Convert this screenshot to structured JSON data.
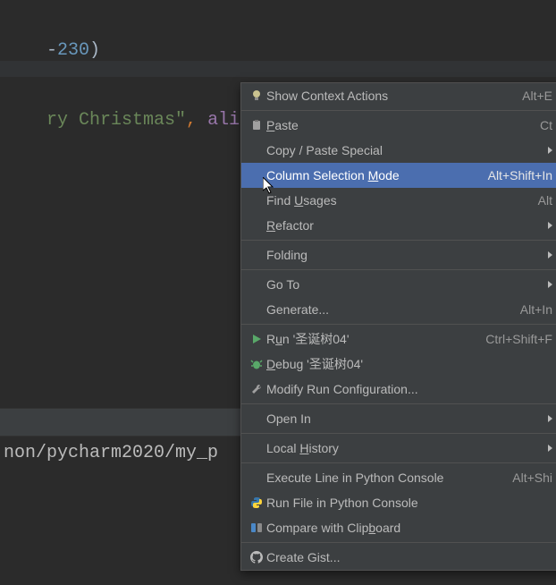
{
  "code": {
    "line1_pre": "-",
    "line1_num": "230",
    "line1_post": ")",
    "line2_pre": "ry Christmas\"",
    "line2_mid": ", ",
    "line2_kw": "alig"
  },
  "console": {
    "path": "non/pycharm2020/my_p"
  },
  "menu": {
    "show_actions": {
      "label": "Show Context Actions",
      "shortcut": "Alt+E"
    },
    "paste": {
      "label_pre": "",
      "mn": "P",
      "label_post": "aste",
      "shortcut": "Ct"
    },
    "copy_paste": {
      "label": "Copy / Paste Special"
    },
    "column_sel": {
      "label_pre": "Column Selection ",
      "mn": "M",
      "label_post": "ode",
      "shortcut": "Alt+Shift+In"
    },
    "find_usages": {
      "label_pre": "Find ",
      "mn": "U",
      "label_post": "sages",
      "shortcut": "Alt"
    },
    "refactor": {
      "label_pre": "",
      "mn": "R",
      "label_post": "efactor"
    },
    "folding": {
      "label": "Folding"
    },
    "goto": {
      "label": "Go To"
    },
    "generate": {
      "label": "Generate...",
      "shortcut": "Alt+In"
    },
    "run": {
      "label_pre": "R",
      "mn": "u",
      "label_post": "n '圣诞树04'",
      "shortcut": "Ctrl+Shift+F"
    },
    "debug": {
      "label_pre": "",
      "mn": "D",
      "label_post": "ebug '圣诞树04'"
    },
    "modify_run": {
      "label": "Modify Run Configuration..."
    },
    "open_in": {
      "label": "Open In"
    },
    "local_hist": {
      "label_pre": "Local ",
      "mn": "H",
      "label_post": "istory"
    },
    "exec_line": {
      "label": "Execute Line in Python Console",
      "shortcut": "Alt+Shi"
    },
    "run_file": {
      "label": "Run File in Python Console"
    },
    "compare_clip": {
      "label_pre": "Compare with Clip",
      "mn": "b",
      "label_post": "oard"
    },
    "create_gist": {
      "label": "Create Gist..."
    }
  },
  "colors": {
    "highlight": "#4b6eaf",
    "menu_bg": "#3c3f41",
    "editor_bg": "#2b2b2b"
  }
}
